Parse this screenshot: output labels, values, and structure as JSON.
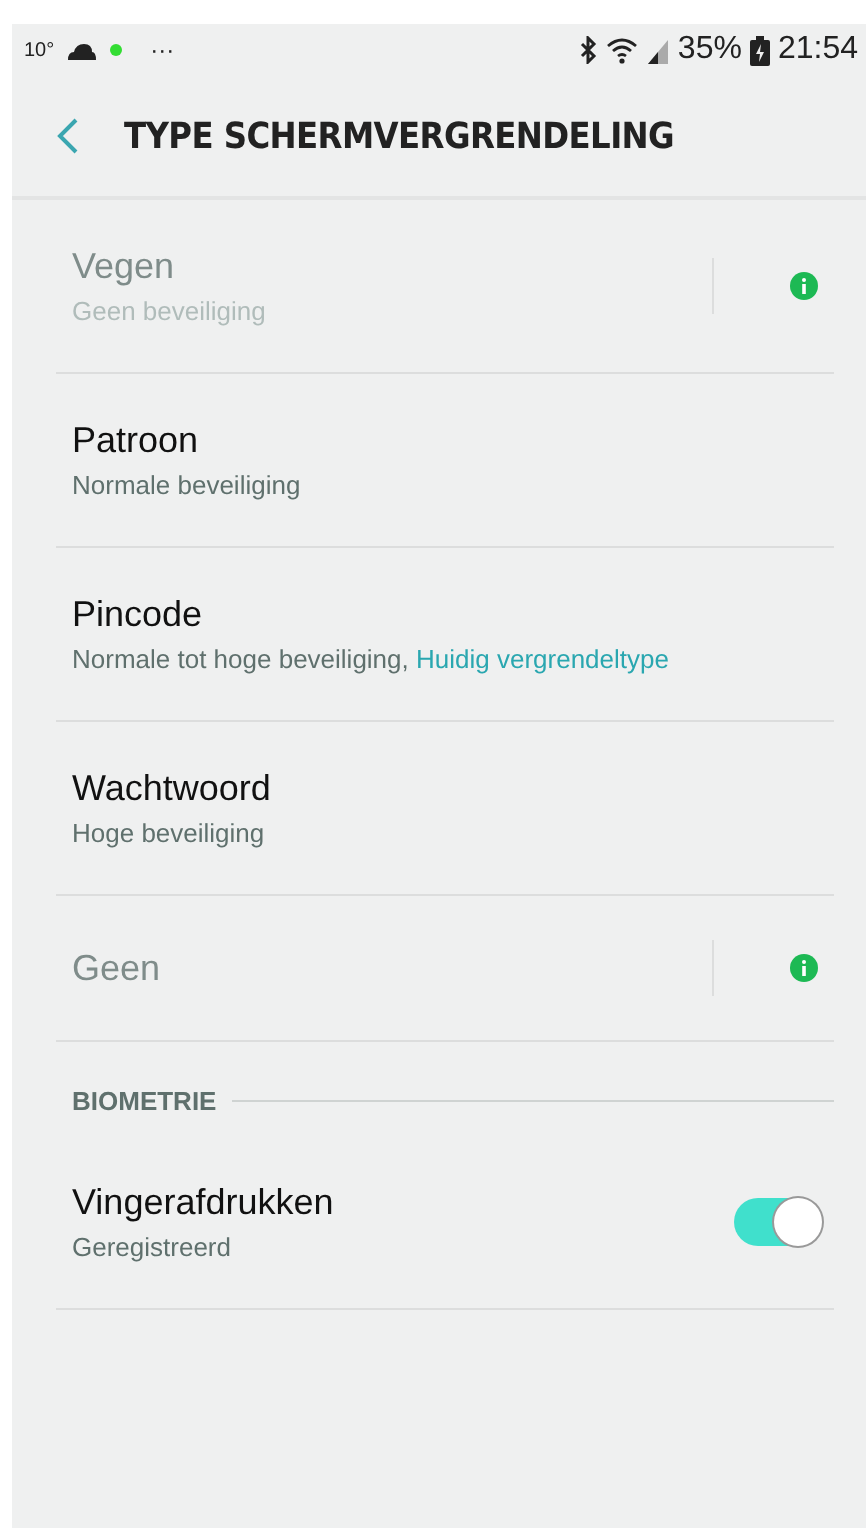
{
  "status_bar": {
    "temperature": "10°",
    "notifications": "···",
    "battery": "35%",
    "time": "21:54"
  },
  "header": {
    "title": "TYPE SCHERMVERGRENDELING"
  },
  "options": [
    {
      "kind": "option",
      "title": "Vegen",
      "subtitle": "Geen beveiliging",
      "disabled": true,
      "info": true
    },
    {
      "kind": "option",
      "title": "Patroon",
      "subtitle": "Normale beveiliging",
      "disabled": false,
      "info": false
    },
    {
      "kind": "option",
      "title": "Pincode",
      "subtitle": "Normale tot hoge beveiliging, ",
      "link": "Huidig vergrendeltype",
      "disabled": false,
      "info": false
    },
    {
      "kind": "option",
      "title": "Wachtwoord",
      "subtitle": "Hoge beveiliging",
      "disabled": false,
      "info": false
    },
    {
      "kind": "option",
      "title": "Geen",
      "disabled": true,
      "info": true
    }
  ],
  "biometrics": {
    "heading": "BIOMETRIE",
    "items": [
      {
        "kind": "toggle",
        "title": "Vingerafdrukken",
        "subtitle": "Geregistreerd",
        "on": true
      }
    ]
  }
}
